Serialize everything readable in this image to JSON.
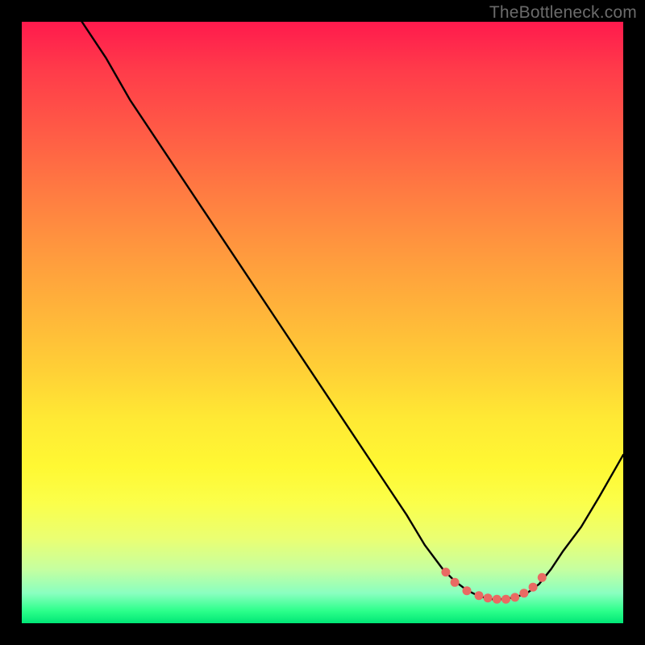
{
  "watermark": "TheBottleneck.com",
  "chart_data": {
    "type": "line",
    "title": "",
    "xlabel": "",
    "ylabel": "",
    "xlim": [
      0,
      100
    ],
    "ylim": [
      0,
      100
    ],
    "series": [
      {
        "name": "curve",
        "x": [
          10,
          14,
          18,
          24,
          30,
          36,
          42,
          48,
          54,
          60,
          64,
          67,
          70,
          72,
          74,
          76,
          78,
          80,
          82,
          84,
          86,
          88,
          90,
          93,
          96,
          100
        ],
        "y": [
          100,
          94,
          87,
          78,
          69,
          60,
          51,
          42,
          33,
          24,
          18,
          13,
          9,
          7,
          5.5,
          4.5,
          4,
          4,
          4.3,
          5,
          6.5,
          9,
          12,
          16,
          21,
          28
        ]
      }
    ],
    "markers": {
      "name": "bottom-dots",
      "x": [
        70.5,
        72,
        74,
        76,
        77.5,
        79,
        80.5,
        82,
        83.5,
        85,
        86.5
      ],
      "y": [
        8.5,
        6.8,
        5.4,
        4.6,
        4.2,
        4.0,
        4.0,
        4.3,
        5.0,
        6.0,
        7.6
      ]
    },
    "colors": {
      "curve": "#000000",
      "marker": "#e96a63"
    }
  }
}
